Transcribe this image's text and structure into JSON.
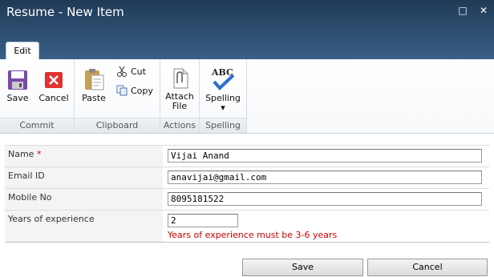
{
  "window": {
    "title": "Resume - New Item"
  },
  "tabs": [
    {
      "label": "Edit"
    }
  ],
  "ribbon": {
    "commit": {
      "label": "Commit",
      "save": "Save",
      "cancel": "Cancel"
    },
    "clipboard": {
      "label": "Clipboard",
      "paste": "Paste",
      "cut": "Cut",
      "copy": "Copy"
    },
    "actions": {
      "label": "Actions",
      "attach_line1": "Attach",
      "attach_line2": "File"
    },
    "spelling": {
      "label": "Spelling",
      "spelling": "Spelling"
    }
  },
  "form": {
    "fields": [
      {
        "label": "Name",
        "required_mark": "*",
        "value": "Vijai Anand"
      },
      {
        "label": "Email ID",
        "value": "anavijai@gmail.com"
      },
      {
        "label": "Mobile No",
        "value": "8095181522"
      },
      {
        "label": "Years of experience",
        "value": "2",
        "error": "Years of experience must be 3-6 years"
      }
    ]
  },
  "buttons": {
    "save": "Save",
    "cancel": "Cancel"
  }
}
